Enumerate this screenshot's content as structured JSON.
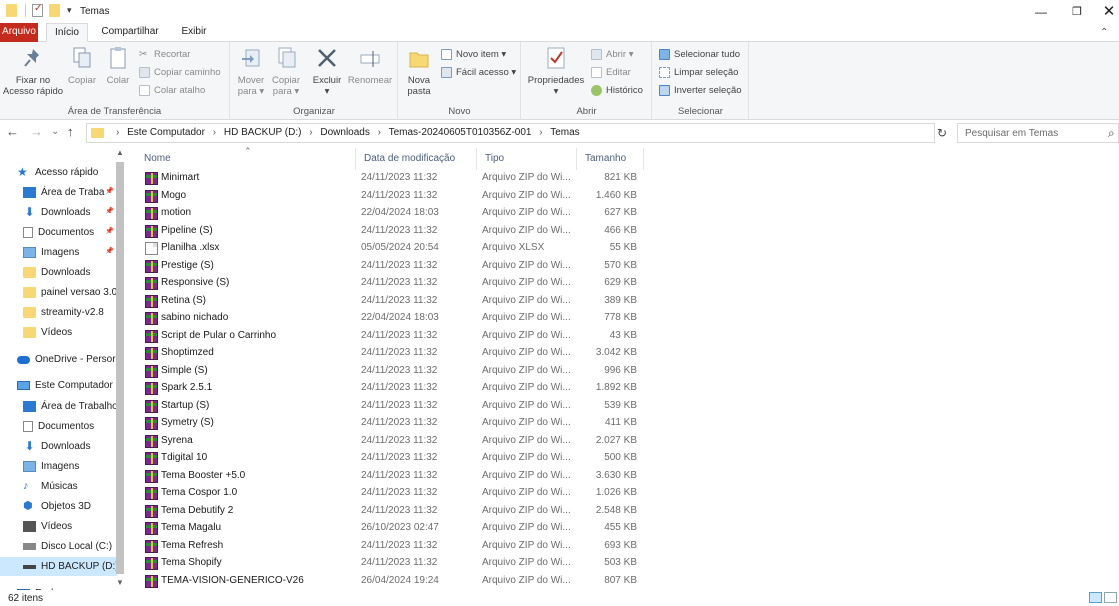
{
  "window": {
    "title": "Temas",
    "minimize": "—",
    "maximize": "❐",
    "close": "✕"
  },
  "ribbon_tabs": {
    "arquivo": "Arquivo",
    "inicio": "Início",
    "compartilhar": "Compartilhar",
    "exibir": "Exibir",
    "help": "⌃"
  },
  "ribbon": {
    "clipboard": {
      "label": "Área de Transferência",
      "pin": "Fixar no\nAcesso rápido",
      "pin_line1": "Fixar no",
      "pin_line2": "Acesso rápido",
      "copy": "Copiar",
      "paste": "Colar",
      "cut": "Recortar",
      "copy_path": "Copiar caminho",
      "paste_shortcut": "Colar atalho"
    },
    "organize": {
      "label": "Organizar",
      "move_line1": "Mover",
      "move_line2": "para ▾",
      "copy_line1": "Copiar",
      "copy_line2": "para ▾",
      "delete": "Excluir",
      "delete_dd": "▾",
      "rename": "Renomear"
    },
    "new": {
      "label": "Novo",
      "new_folder_line1": "Nova",
      "new_folder_line2": "pasta",
      "new_item": "Novo item ▾",
      "easy_access": "Fácil acesso ▾"
    },
    "open": {
      "label": "Abrir",
      "properties": "Propriedades",
      "properties_dd": "▾",
      "open": "Abrir ▾",
      "edit": "Editar",
      "history": "Histórico"
    },
    "select": {
      "label": "Selecionar",
      "select_all": "Selecionar tudo",
      "select_none": "Limpar seleção",
      "invert": "Inverter seleção"
    }
  },
  "navbar": {
    "back": "←",
    "forward": "→",
    "recent": "⌄",
    "up": "↑",
    "crumbs": [
      "Este Computador",
      "HD BACKUP (D:)",
      "Downloads",
      "Temas-20240605T010356Z-001",
      "Temas"
    ],
    "separator": "›",
    "search_placeholder": "Pesquisar em Temas",
    "refresh": "↻",
    "dropdown": "⌄",
    "search_icon": "⌕"
  },
  "nav_pane": {
    "items": [
      {
        "label": "Acesso rápido",
        "icon": "star-icon",
        "indent": 0,
        "pinned": false
      },
      {
        "label": "Área de Traba",
        "icon": "desktop-icon",
        "indent": 1,
        "pinned": true
      },
      {
        "label": "Downloads",
        "icon": "download-icon",
        "indent": 1,
        "pinned": true
      },
      {
        "label": "Documentos",
        "icon": "document-icon",
        "indent": 1,
        "pinned": true
      },
      {
        "label": "Imagens",
        "icon": "pictures-icon",
        "indent": 1,
        "pinned": true
      },
      {
        "label": "Downloads",
        "icon": "folder-icon",
        "indent": 1,
        "pinned": false
      },
      {
        "label": "painel versao 3.0",
        "icon": "folder-icon",
        "indent": 1,
        "pinned": false
      },
      {
        "label": "streamity-v2.8",
        "icon": "folder-icon",
        "indent": 1,
        "pinned": false
      },
      {
        "label": "Vídeos",
        "icon": "folder-icon",
        "indent": 1,
        "pinned": false
      },
      {
        "label": "OneDrive - Persor",
        "icon": "cloud-icon",
        "indent": 0,
        "pinned": false
      },
      {
        "label": "Este Computador",
        "icon": "computer-icon",
        "indent": 0,
        "pinned": false
      },
      {
        "label": "Área de Trabalho",
        "icon": "desktop-icon",
        "indent": 1,
        "pinned": false
      },
      {
        "label": "Documentos",
        "icon": "document-icon",
        "indent": 1,
        "pinned": false
      },
      {
        "label": "Downloads",
        "icon": "download-icon",
        "indent": 1,
        "pinned": false
      },
      {
        "label": "Imagens",
        "icon": "pictures-icon",
        "indent": 1,
        "pinned": false
      },
      {
        "label": "Músicas",
        "icon": "music-icon",
        "indent": 1,
        "pinned": false
      },
      {
        "label": "Objetos 3D",
        "icon": "objects-3d-icon",
        "indent": 1,
        "pinned": false
      },
      {
        "label": "Vídeos",
        "icon": "video-icon",
        "indent": 1,
        "pinned": false
      },
      {
        "label": "Disco Local (C:)",
        "icon": "drive-icon",
        "indent": 1,
        "pinned": false
      },
      {
        "label": "HD BACKUP (D:)",
        "icon": "hdd-icon",
        "indent": 1,
        "pinned": false,
        "selected": true
      },
      {
        "label": "Rede",
        "icon": "network-icon",
        "indent": 0,
        "pinned": false
      }
    ]
  },
  "columns": {
    "name": "Nome",
    "date": "Data de modificação",
    "type": "Tipo",
    "size": "Tamanho"
  },
  "files": [
    {
      "name": "Minimart",
      "date": "24/11/2023 11:32",
      "type": "Arquivo ZIP do Wi...",
      "size": "821 KB",
      "kind": "zip"
    },
    {
      "name": "Mogo",
      "date": "24/11/2023 11:32",
      "type": "Arquivo ZIP do Wi...",
      "size": "1.460 KB",
      "kind": "zip"
    },
    {
      "name": "motion",
      "date": "22/04/2024 18:03",
      "type": "Arquivo ZIP do Wi...",
      "size": "627 KB",
      "kind": "zip"
    },
    {
      "name": "Pipeline (S)",
      "date": "24/11/2023 11:32",
      "type": "Arquivo ZIP do Wi...",
      "size": "466 KB",
      "kind": "zip"
    },
    {
      "name": "Planilha .xlsx",
      "date": "05/05/2024 20:54",
      "type": "Arquivo XLSX",
      "size": "55 KB",
      "kind": "xlsx"
    },
    {
      "name": "Prestige (S)",
      "date": "24/11/2023 11:32",
      "type": "Arquivo ZIP do Wi...",
      "size": "570 KB",
      "kind": "zip"
    },
    {
      "name": "Responsive (S)",
      "date": "24/11/2023 11:32",
      "type": "Arquivo ZIP do Wi...",
      "size": "629 KB",
      "kind": "zip"
    },
    {
      "name": "Retina (S)",
      "date": "24/11/2023 11:32",
      "type": "Arquivo ZIP do Wi...",
      "size": "389 KB",
      "kind": "zip"
    },
    {
      "name": "sabino nichado",
      "date": "22/04/2024 18:03",
      "type": "Arquivo ZIP do Wi...",
      "size": "778 KB",
      "kind": "zip"
    },
    {
      "name": "Script de Pular o Carrinho",
      "date": "24/11/2023 11:32",
      "type": "Arquivo ZIP do Wi...",
      "size": "43 KB",
      "kind": "zip"
    },
    {
      "name": "Shoptimzed",
      "date": "24/11/2023 11:32",
      "type": "Arquivo ZIP do Wi...",
      "size": "3.042 KB",
      "kind": "zip"
    },
    {
      "name": "Simple (S)",
      "date": "24/11/2023 11:32",
      "type": "Arquivo ZIP do Wi...",
      "size": "996 KB",
      "kind": "zip"
    },
    {
      "name": "Spark 2.5.1",
      "date": "24/11/2023 11:32",
      "type": "Arquivo ZIP do Wi...",
      "size": "1.892 KB",
      "kind": "zip"
    },
    {
      "name": "Startup (S)",
      "date": "24/11/2023 11:32",
      "type": "Arquivo ZIP do Wi...",
      "size": "539 KB",
      "kind": "zip"
    },
    {
      "name": "Symetry (S)",
      "date": "24/11/2023 11:32",
      "type": "Arquivo ZIP do Wi...",
      "size": "411 KB",
      "kind": "zip"
    },
    {
      "name": "Syrena",
      "date": "24/11/2023 11:32",
      "type": "Arquivo ZIP do Wi...",
      "size": "2.027 KB",
      "kind": "zip"
    },
    {
      "name": "Tdigital 10",
      "date": "24/11/2023 11:32",
      "type": "Arquivo ZIP do Wi...",
      "size": "500 KB",
      "kind": "zip"
    },
    {
      "name": "Tema Booster +5.0",
      "date": "24/11/2023 11:32",
      "type": "Arquivo ZIP do Wi...",
      "size": "3.630 KB",
      "kind": "zip"
    },
    {
      "name": "Tema Cospor 1.0",
      "date": "24/11/2023 11:32",
      "type": "Arquivo ZIP do Wi...",
      "size": "1.026 KB",
      "kind": "zip"
    },
    {
      "name": "Tema Debutify 2",
      "date": "24/11/2023 11:32",
      "type": "Arquivo ZIP do Wi...",
      "size": "2.548 KB",
      "kind": "zip"
    },
    {
      "name": "Tema Magalu",
      "date": "26/10/2023 02:47",
      "type": "Arquivo ZIP do Wi...",
      "size": "455 KB",
      "kind": "zip"
    },
    {
      "name": "Tema Refresh",
      "date": "24/11/2023 11:32",
      "type": "Arquivo ZIP do Wi...",
      "size": "693 KB",
      "kind": "zip"
    },
    {
      "name": "Tema Shopify",
      "date": "24/11/2023 11:32",
      "type": "Arquivo ZIP do Wi...",
      "size": "503 KB",
      "kind": "zip"
    },
    {
      "name": "TEMA-VISION-GENERICO-V26",
      "date": "26/04/2024 19:24",
      "type": "Arquivo ZIP do Wi...",
      "size": "807 KB",
      "kind": "zip"
    }
  ],
  "status": {
    "item_count": "62 itens"
  },
  "colors": {
    "accent": "#c42b1c",
    "selection": "#cce8ff",
    "folder": "#f8d775",
    "header_text": "#4c607a"
  }
}
